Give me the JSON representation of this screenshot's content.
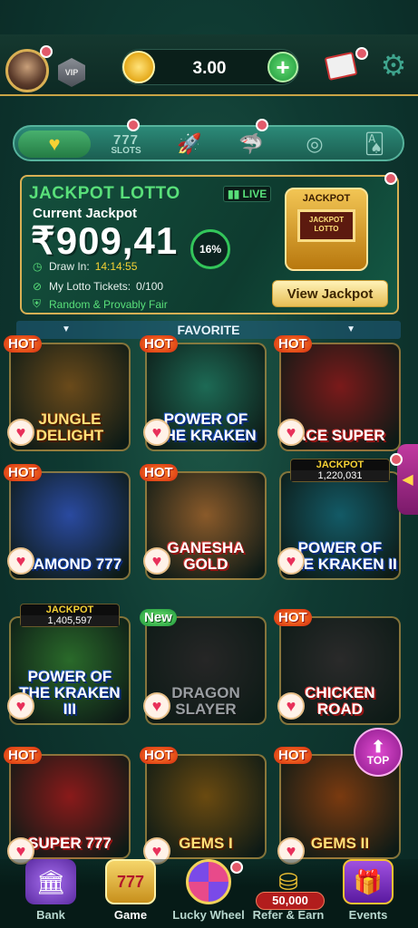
{
  "header": {
    "coins": "3.00",
    "vip_label": "VIP"
  },
  "categories": {
    "slots_label": "SLOTS",
    "slots_digits": "777"
  },
  "jackpot": {
    "title": "JACKPOT LOTTO",
    "live_label": "LIVE",
    "current_label": "Current Jackpot",
    "amount": "₹909,41",
    "progress_percent": "16%",
    "draw_label": "Draw In:",
    "draw_time": "14:14:55",
    "tickets_label": "My Lotto Tickets:",
    "tickets_value": "0/100",
    "fair_label": "Random & Provably Fair",
    "machine_label": "JACKPOT",
    "machine_screen": "JACKPOT LOTTO",
    "view_button": "View Jackpot"
  },
  "favorite_label": "FAVORITE",
  "games": [
    {
      "name": "JUNGLE DELIGHT",
      "badge": "HOT",
      "jackpot_label": "",
      "jackpot_value": "",
      "color": "#6a4a1a"
    },
    {
      "name": "POWER OF THE KRAKEN",
      "badge": "HOT",
      "jackpot_label": "",
      "jackpot_value": "",
      "color": "#1d6a55"
    },
    {
      "name": "ACE SUPER",
      "badge": "HOT",
      "jackpot_label": "",
      "jackpot_value": "",
      "color": "#7a1a1a"
    },
    {
      "name": "DIAMOND 777",
      "badge": "HOT",
      "jackpot_label": "",
      "jackpot_value": "",
      "color": "#2a4aa0"
    },
    {
      "name": "GANESHA GOLD",
      "badge": "HOT",
      "jackpot_label": "",
      "jackpot_value": "",
      "color": "#8a5a2a"
    },
    {
      "name": "POWER OF THE KRAKEN II",
      "badge": "",
      "jackpot_label": "JACKPOT",
      "jackpot_value": "1,220,031",
      "color": "#135a66"
    },
    {
      "name": "POWER OF THE KRAKEN III",
      "badge": "",
      "jackpot_label": "JACKPOT",
      "jackpot_value": "1,405,597",
      "color": "#2a6a2a"
    },
    {
      "name": "DRAGON SLAYER",
      "badge": "New",
      "jackpot_label": "",
      "jackpot_value": "",
      "color": "#262626"
    },
    {
      "name": "CHICKEN ROAD",
      "badge": "HOT",
      "jackpot_label": "",
      "jackpot_value": "",
      "color": "#2a2a2a"
    },
    {
      "name": "SUPER 777",
      "badge": "HOT",
      "jackpot_label": "",
      "jackpot_value": "",
      "color": "#8a1a1a"
    },
    {
      "name": "GEMS I",
      "badge": "HOT",
      "jackpot_label": "",
      "jackpot_value": "",
      "color": "#6a4a10"
    },
    {
      "name": "GEMS II",
      "badge": "HOT",
      "jackpot_label": "",
      "jackpot_value": "",
      "color": "#7a3a10"
    }
  ],
  "top_button": "TOP",
  "nav": [
    {
      "label": "Bank"
    },
    {
      "label": "Game"
    },
    {
      "label": "Lucky Wheel"
    },
    {
      "label": "Refer & Earn"
    },
    {
      "label": "Events"
    }
  ],
  "refer_amount": "50,000"
}
